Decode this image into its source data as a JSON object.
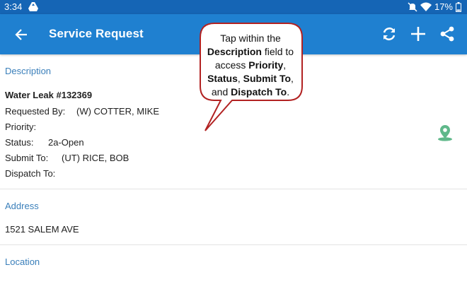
{
  "statusbar": {
    "time": "3:34",
    "battery": "17%",
    "icons": [
      "drive-icon",
      "mute-icon",
      "wifi-icon",
      "battery-icon"
    ]
  },
  "appbar": {
    "title": "Service Request",
    "actions": [
      "refresh-icon",
      "add-icon",
      "share-icon"
    ],
    "color": "#1f80d0"
  },
  "description": {
    "label": "Description",
    "title": "Water Leak #132369",
    "requested_by_label": "Requested By:",
    "requested_by_value": "(W) COTTER, MIKE",
    "priority_label": "Priority:",
    "status_label": "Status:",
    "status_value": "2a-Open",
    "submit_to_label": "Submit To:",
    "submit_to_value": "(UT) RICE, BOB",
    "dispatch_to_label": "Dispatch To:"
  },
  "address": {
    "label": "Address",
    "value": "1521 SALEM AVE"
  },
  "location": {
    "label": "Location"
  },
  "callout": {
    "t1": "Tap within the",
    "t2a": "Description",
    "t2b": " field to",
    "t3a": "access ",
    "t3b": "Priority",
    "t3c": ",",
    "t4a": "Status",
    "t4b": ", ",
    "t4c": "Submit To",
    "t4d": ",",
    "t5a": "and ",
    "t5b": "Dispatch To",
    "t5c": "."
  },
  "colors": {
    "statusbar": "#1565b5",
    "accent_label": "#3a7fba",
    "pin": "#5fb88a",
    "callout_border": "#b22222"
  }
}
